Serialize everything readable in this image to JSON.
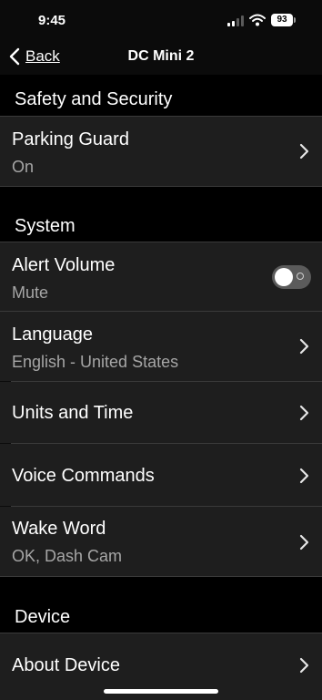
{
  "status": {
    "time": "9:45",
    "battery": "93"
  },
  "nav": {
    "back_label": "Back",
    "title": "DC Mini 2"
  },
  "sections": {
    "safety": {
      "title": "Safety and Security",
      "parking_guard": {
        "title": "Parking Guard",
        "value": "On"
      }
    },
    "system": {
      "title": "System",
      "alert_volume": {
        "title": "Alert Volume",
        "value": "Mute",
        "toggle_on": false
      },
      "language": {
        "title": "Language",
        "value": "English - United States"
      },
      "units_time": {
        "title": "Units and Time"
      },
      "voice_commands": {
        "title": "Voice Commands"
      },
      "wake_word": {
        "title": "Wake Word",
        "value": "OK, Dash Cam"
      }
    },
    "device": {
      "title": "Device",
      "about_device": {
        "title": "About Device"
      }
    }
  },
  "colors": {
    "background": "#0b0b0b",
    "row": "#1e1e1e",
    "subtitle": "#a6a6a6",
    "toggle_off": "#5b5b5b"
  },
  "icons": [
    "chevron-left-icon",
    "chevron-right-icon",
    "signal-icon",
    "wifi-icon",
    "battery-icon"
  ]
}
